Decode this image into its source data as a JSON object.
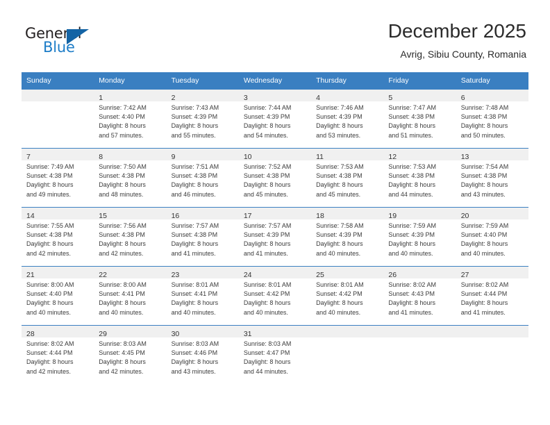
{
  "brand": {
    "name_top": "General",
    "name_bottom": "Blue",
    "logo_color": "#1464a5",
    "text_color": "#231f20",
    "blue_text_color": "#1c7cc7"
  },
  "header": {
    "title": "December 2025",
    "subtitle": "Avrig, Sibiu County, Romania"
  },
  "calendar": {
    "accent_color": "#3a7fc1",
    "daynum_bg": "#f0f0f0",
    "weekday_headers": [
      "Sunday",
      "Monday",
      "Tuesday",
      "Wednesday",
      "Thursday",
      "Friday",
      "Saturday"
    ],
    "weeks": [
      [
        {
          "day": "",
          "sunrise": "",
          "sunset": "",
          "daylight_line1": "",
          "daylight_line2": "",
          "empty": true
        },
        {
          "day": "1",
          "sunrise": "Sunrise: 7:42 AM",
          "sunset": "Sunset: 4:40 PM",
          "daylight_line1": "Daylight: 8 hours",
          "daylight_line2": "and 57 minutes.",
          "empty": false
        },
        {
          "day": "2",
          "sunrise": "Sunrise: 7:43 AM",
          "sunset": "Sunset: 4:39 PM",
          "daylight_line1": "Daylight: 8 hours",
          "daylight_line2": "and 55 minutes.",
          "empty": false
        },
        {
          "day": "3",
          "sunrise": "Sunrise: 7:44 AM",
          "sunset": "Sunset: 4:39 PM",
          "daylight_line1": "Daylight: 8 hours",
          "daylight_line2": "and 54 minutes.",
          "empty": false
        },
        {
          "day": "4",
          "sunrise": "Sunrise: 7:46 AM",
          "sunset": "Sunset: 4:39 PM",
          "daylight_line1": "Daylight: 8 hours",
          "daylight_line2": "and 53 minutes.",
          "empty": false
        },
        {
          "day": "5",
          "sunrise": "Sunrise: 7:47 AM",
          "sunset": "Sunset: 4:38 PM",
          "daylight_line1": "Daylight: 8 hours",
          "daylight_line2": "and 51 minutes.",
          "empty": false
        },
        {
          "day": "6",
          "sunrise": "Sunrise: 7:48 AM",
          "sunset": "Sunset: 4:38 PM",
          "daylight_line1": "Daylight: 8 hours",
          "daylight_line2": "and 50 minutes.",
          "empty": false
        }
      ],
      [
        {
          "day": "7",
          "sunrise": "Sunrise: 7:49 AM",
          "sunset": "Sunset: 4:38 PM",
          "daylight_line1": "Daylight: 8 hours",
          "daylight_line2": "and 49 minutes.",
          "empty": false
        },
        {
          "day": "8",
          "sunrise": "Sunrise: 7:50 AM",
          "sunset": "Sunset: 4:38 PM",
          "daylight_line1": "Daylight: 8 hours",
          "daylight_line2": "and 48 minutes.",
          "empty": false
        },
        {
          "day": "9",
          "sunrise": "Sunrise: 7:51 AM",
          "sunset": "Sunset: 4:38 PM",
          "daylight_line1": "Daylight: 8 hours",
          "daylight_line2": "and 46 minutes.",
          "empty": false
        },
        {
          "day": "10",
          "sunrise": "Sunrise: 7:52 AM",
          "sunset": "Sunset: 4:38 PM",
          "daylight_line1": "Daylight: 8 hours",
          "daylight_line2": "and 45 minutes.",
          "empty": false
        },
        {
          "day": "11",
          "sunrise": "Sunrise: 7:53 AM",
          "sunset": "Sunset: 4:38 PM",
          "daylight_line1": "Daylight: 8 hours",
          "daylight_line2": "and 45 minutes.",
          "empty": false
        },
        {
          "day": "12",
          "sunrise": "Sunrise: 7:53 AM",
          "sunset": "Sunset: 4:38 PM",
          "daylight_line1": "Daylight: 8 hours",
          "daylight_line2": "and 44 minutes.",
          "empty": false
        },
        {
          "day": "13",
          "sunrise": "Sunrise: 7:54 AM",
          "sunset": "Sunset: 4:38 PM",
          "daylight_line1": "Daylight: 8 hours",
          "daylight_line2": "and 43 minutes.",
          "empty": false
        }
      ],
      [
        {
          "day": "14",
          "sunrise": "Sunrise: 7:55 AM",
          "sunset": "Sunset: 4:38 PM",
          "daylight_line1": "Daylight: 8 hours",
          "daylight_line2": "and 42 minutes.",
          "empty": false
        },
        {
          "day": "15",
          "sunrise": "Sunrise: 7:56 AM",
          "sunset": "Sunset: 4:38 PM",
          "daylight_line1": "Daylight: 8 hours",
          "daylight_line2": "and 42 minutes.",
          "empty": false
        },
        {
          "day": "16",
          "sunrise": "Sunrise: 7:57 AM",
          "sunset": "Sunset: 4:38 PM",
          "daylight_line1": "Daylight: 8 hours",
          "daylight_line2": "and 41 minutes.",
          "empty": false
        },
        {
          "day": "17",
          "sunrise": "Sunrise: 7:57 AM",
          "sunset": "Sunset: 4:39 PM",
          "daylight_line1": "Daylight: 8 hours",
          "daylight_line2": "and 41 minutes.",
          "empty": false
        },
        {
          "day": "18",
          "sunrise": "Sunrise: 7:58 AM",
          "sunset": "Sunset: 4:39 PM",
          "daylight_line1": "Daylight: 8 hours",
          "daylight_line2": "and 40 minutes.",
          "empty": false
        },
        {
          "day": "19",
          "sunrise": "Sunrise: 7:59 AM",
          "sunset": "Sunset: 4:39 PM",
          "daylight_line1": "Daylight: 8 hours",
          "daylight_line2": "and 40 minutes.",
          "empty": false
        },
        {
          "day": "20",
          "sunrise": "Sunrise: 7:59 AM",
          "sunset": "Sunset: 4:40 PM",
          "daylight_line1": "Daylight: 8 hours",
          "daylight_line2": "and 40 minutes.",
          "empty": false
        }
      ],
      [
        {
          "day": "21",
          "sunrise": "Sunrise: 8:00 AM",
          "sunset": "Sunset: 4:40 PM",
          "daylight_line1": "Daylight: 8 hours",
          "daylight_line2": "and 40 minutes.",
          "empty": false
        },
        {
          "day": "22",
          "sunrise": "Sunrise: 8:00 AM",
          "sunset": "Sunset: 4:41 PM",
          "daylight_line1": "Daylight: 8 hours",
          "daylight_line2": "and 40 minutes.",
          "empty": false
        },
        {
          "day": "23",
          "sunrise": "Sunrise: 8:01 AM",
          "sunset": "Sunset: 4:41 PM",
          "daylight_line1": "Daylight: 8 hours",
          "daylight_line2": "and 40 minutes.",
          "empty": false
        },
        {
          "day": "24",
          "sunrise": "Sunrise: 8:01 AM",
          "sunset": "Sunset: 4:42 PM",
          "daylight_line1": "Daylight: 8 hours",
          "daylight_line2": "and 40 minutes.",
          "empty": false
        },
        {
          "day": "25",
          "sunrise": "Sunrise: 8:01 AM",
          "sunset": "Sunset: 4:42 PM",
          "daylight_line1": "Daylight: 8 hours",
          "daylight_line2": "and 40 minutes.",
          "empty": false
        },
        {
          "day": "26",
          "sunrise": "Sunrise: 8:02 AM",
          "sunset": "Sunset: 4:43 PM",
          "daylight_line1": "Daylight: 8 hours",
          "daylight_line2": "and 41 minutes.",
          "empty": false
        },
        {
          "day": "27",
          "sunrise": "Sunrise: 8:02 AM",
          "sunset": "Sunset: 4:44 PM",
          "daylight_line1": "Daylight: 8 hours",
          "daylight_line2": "and 41 minutes.",
          "empty": false
        }
      ],
      [
        {
          "day": "28",
          "sunrise": "Sunrise: 8:02 AM",
          "sunset": "Sunset: 4:44 PM",
          "daylight_line1": "Daylight: 8 hours",
          "daylight_line2": "and 42 minutes.",
          "empty": false
        },
        {
          "day": "29",
          "sunrise": "Sunrise: 8:03 AM",
          "sunset": "Sunset: 4:45 PM",
          "daylight_line1": "Daylight: 8 hours",
          "daylight_line2": "and 42 minutes.",
          "empty": false
        },
        {
          "day": "30",
          "sunrise": "Sunrise: 8:03 AM",
          "sunset": "Sunset: 4:46 PM",
          "daylight_line1": "Daylight: 8 hours",
          "daylight_line2": "and 43 minutes.",
          "empty": false
        },
        {
          "day": "31",
          "sunrise": "Sunrise: 8:03 AM",
          "sunset": "Sunset: 4:47 PM",
          "daylight_line1": "Daylight: 8 hours",
          "daylight_line2": "and 44 minutes.",
          "empty": false
        },
        {
          "day": "",
          "sunrise": "",
          "sunset": "",
          "daylight_line1": "",
          "daylight_line2": "",
          "empty": true
        },
        {
          "day": "",
          "sunrise": "",
          "sunset": "",
          "daylight_line1": "",
          "daylight_line2": "",
          "empty": true
        },
        {
          "day": "",
          "sunrise": "",
          "sunset": "",
          "daylight_line1": "",
          "daylight_line2": "",
          "empty": true
        }
      ]
    ]
  }
}
